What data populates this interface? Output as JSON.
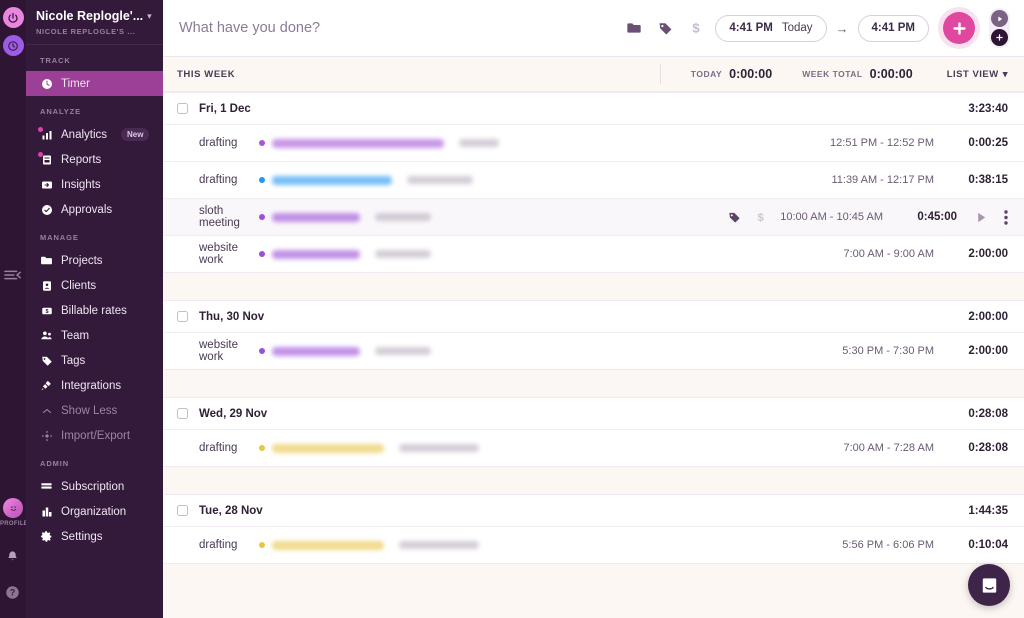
{
  "rail": {
    "power_icon": "power-icon",
    "clock_icon": "clock-icon",
    "collapse_icon": "collapse-sidebar-icon",
    "avatar_icon": "avatar-icon",
    "profile_label": "PROFILE",
    "bell_icon": "bell-icon",
    "help_icon": "help-icon"
  },
  "sidebar": {
    "workspace_name": "Nicole Replogle'...",
    "workspace_sub": "NICOLE REPLOGLE'S ...",
    "chevron": "▾",
    "sections": [
      {
        "label": "TRACK",
        "items": [
          {
            "label": "Timer",
            "icon": "clock-icon",
            "active": true
          }
        ]
      },
      {
        "label": "ANALYZE",
        "items": [
          {
            "label": "Analytics",
            "icon": "bar-chart-icon",
            "badge": "New"
          },
          {
            "label": "Reports",
            "icon": "report-icon"
          },
          {
            "label": "Insights",
            "icon": "insights-icon"
          },
          {
            "label": "Approvals",
            "icon": "check-circle-icon"
          }
        ]
      },
      {
        "label": "MANAGE",
        "items": [
          {
            "label": "Projects",
            "icon": "folder-icon"
          },
          {
            "label": "Clients",
            "icon": "person-card-icon"
          },
          {
            "label": "Billable rates",
            "icon": "money-icon"
          },
          {
            "label": "Team",
            "icon": "team-icon"
          },
          {
            "label": "Tags",
            "icon": "tag-icon"
          },
          {
            "label": "Integrations",
            "icon": "plug-icon"
          },
          {
            "label": "Show Less",
            "icon": "chevron-up-icon",
            "dim": true
          },
          {
            "label": "Import/Export",
            "icon": "import-export-icon",
            "dim": true
          }
        ]
      },
      {
        "label": "ADMIN",
        "items": [
          {
            "label": "Subscription",
            "icon": "card-icon"
          },
          {
            "label": "Organization",
            "icon": "building-icon"
          },
          {
            "label": "Settings",
            "icon": "gear-icon"
          }
        ]
      }
    ]
  },
  "topbar": {
    "task_placeholder": "What have you done?",
    "task_value": "",
    "project_icon": "folder-icon",
    "tag_icon": "tag-icon",
    "billable_icon": "dollar-icon",
    "start_time": "4:41 PM",
    "start_day": "Today",
    "arrow": "→",
    "end_time": "4:41 PM",
    "start_button_icon": "plus-icon",
    "mode_timer_icon": "play-icon",
    "mode_manual_icon": "plus-icon"
  },
  "weekbar": {
    "title": "THIS WEEK",
    "today_label": "TODAY",
    "today_value": "0:00:00",
    "week_total_label": "WEEK TOTAL",
    "week_total_value": "0:00:00",
    "view_label": "LIST VIEW",
    "view_chevron": "▾"
  },
  "colors": {
    "accent_pink": "#e0479f",
    "sidebar_bg": "#33193a",
    "rail_bg": "#2e1533",
    "active_nav": "#9c3f96",
    "band_bg": "#fdf7f4"
  },
  "days": [
    {
      "date": "Fri, 1 Dec",
      "total": "3:23:40",
      "entries": [
        {
          "description": "drafting",
          "dot_color": "#a855d8",
          "project_w": 172,
          "client_w": 40,
          "times": "12:51 PM - 12:52 PM",
          "duration": "0:00:25",
          "hovered": false,
          "has_tag": false,
          "has_billable": false
        },
        {
          "description": "drafting",
          "dot_color": "#2196f3",
          "project_w": 120,
          "client_w": 66,
          "times": "11:39 AM - 12:17 PM",
          "duration": "0:38:15",
          "hovered": false,
          "has_tag": false,
          "has_billable": false
        },
        {
          "description": "sloth meeting",
          "dot_color": "#9c4fd8",
          "project_w": 88,
          "client_w": 56,
          "times": "10:00 AM - 10:45 AM",
          "duration": "0:45:00",
          "hovered": true,
          "has_tag": true,
          "has_billable": true
        },
        {
          "description": "website work",
          "dot_color": "#9c4fd8",
          "project_w": 88,
          "client_w": 56,
          "times": "7:00 AM - 9:00 AM",
          "duration": "2:00:00",
          "hovered": false,
          "has_tag": false,
          "has_billable": false
        }
      ]
    },
    {
      "date": "Thu, 30 Nov",
      "total": "2:00:00",
      "entries": [
        {
          "description": "website work",
          "dot_color": "#9c4fd8",
          "project_w": 88,
          "client_w": 56,
          "times": "5:30 PM - 7:30 PM",
          "duration": "2:00:00",
          "hovered": false,
          "has_tag": false,
          "has_billable": false
        }
      ]
    },
    {
      "date": "Wed, 29 Nov",
      "total": "0:28:08",
      "entries": [
        {
          "description": "drafting",
          "dot_color": "#e8c547",
          "project_w": 112,
          "client_w": 80,
          "times": "7:00 AM - 7:28 AM",
          "duration": "0:28:08",
          "hovered": false,
          "has_tag": false,
          "has_billable": false
        }
      ]
    },
    {
      "date": "Tue, 28 Nov",
      "total": "1:44:35",
      "entries": [
        {
          "description": "drafting",
          "dot_color": "#e8c547",
          "project_w": 112,
          "client_w": 80,
          "times": "5:56 PM - 6:06 PM",
          "duration": "0:10:04",
          "hovered": false,
          "has_tag": false,
          "has_billable": false
        }
      ]
    }
  ],
  "chat": {
    "icon": "chat-bubble-icon"
  }
}
